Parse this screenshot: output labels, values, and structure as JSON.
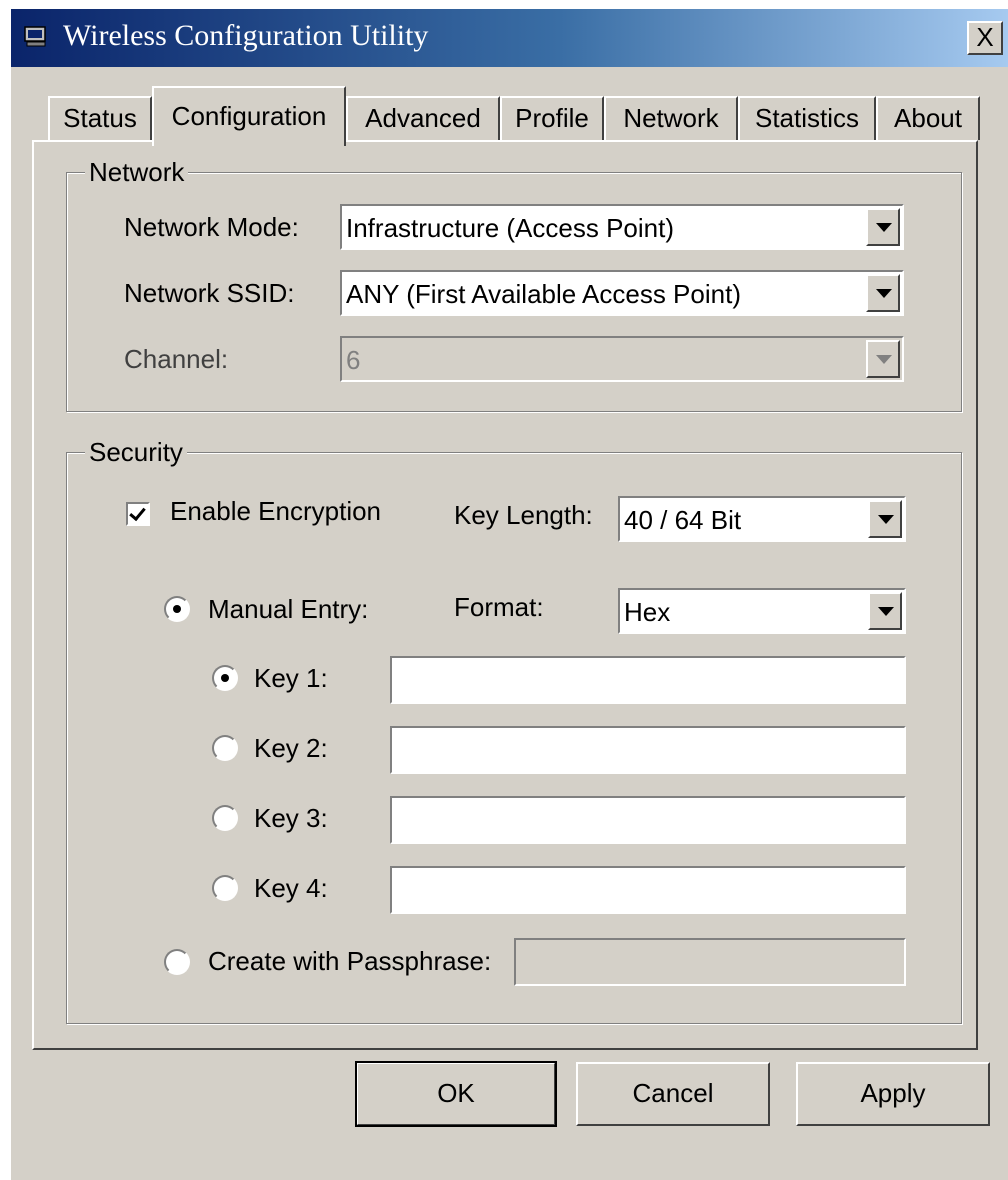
{
  "window": {
    "title": "Wireless Configuration Utility",
    "close_label": "X",
    "app_icon": "monitor-icon"
  },
  "tabs": [
    {
      "label": "Status",
      "active": false
    },
    {
      "label": "Configuration",
      "active": true
    },
    {
      "label": "Advanced",
      "active": false
    },
    {
      "label": "Profile",
      "active": false
    },
    {
      "label": "Network",
      "active": false
    },
    {
      "label": "Statistics",
      "active": false
    },
    {
      "label": "About",
      "active": false
    }
  ],
  "network": {
    "group_label": "Network",
    "mode_label": "Network Mode:",
    "mode_value": "Infrastructure (Access Point)",
    "ssid_label": "Network SSID:",
    "ssid_value": "ANY (First Available Access Point)",
    "channel_label": "Channel:",
    "channel_value": "6"
  },
  "security": {
    "group_label": "Security",
    "enable_encryption_label": "Enable Encryption",
    "enable_encryption_checked": true,
    "key_length_label": "Key Length:",
    "key_length_value": "40 / 64 Bit",
    "manual_entry_label": "Manual Entry:",
    "format_label": "Format:",
    "format_value": "Hex",
    "keys": [
      {
        "label": "Key 1:",
        "selected": true,
        "value": ""
      },
      {
        "label": "Key 2:",
        "selected": false,
        "value": ""
      },
      {
        "label": "Key 3:",
        "selected": false,
        "value": ""
      },
      {
        "label": "Key 4:",
        "selected": false,
        "value": ""
      }
    ],
    "passphrase_label": "Create with Passphrase:",
    "passphrase_value": ""
  },
  "buttons": {
    "ok": "OK",
    "cancel": "Cancel",
    "apply": "Apply"
  }
}
